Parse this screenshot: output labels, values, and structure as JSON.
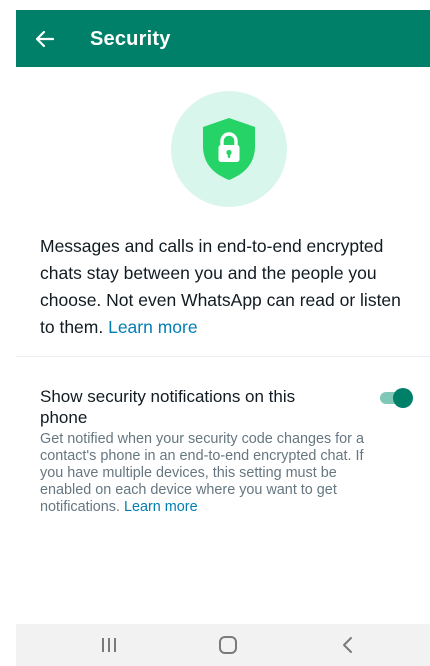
{
  "app_bar": {
    "title": "Security",
    "background": "#008069",
    "back_icon": "arrow-left-icon"
  },
  "hero": {
    "icon": "shield-lock-icon",
    "circle_color": "#d9f6ec",
    "shield_color": "#25d366",
    "text": "Messages and calls in end-to-end encrypted chats stay between you and the people you choose. Not even WhatsApp can read or listen to them. ",
    "link": "Learn more"
  },
  "setting": {
    "title": "Show security notifications on this phone",
    "description": "Get notified when your security code changes for a contact's phone in an end-to-end encrypted chat. If you have multiple devices, this setting must be enabled on each device where you want to get notifications. ",
    "link": "Learn more",
    "toggle_on": true,
    "toggle_color": "#008069"
  },
  "system_nav": {
    "recents_icon": "recents-icon",
    "home_icon": "home-icon",
    "back_icon": "back-chevron-icon"
  },
  "colors": {
    "link": "#027eb5",
    "secondary_text": "#667781"
  }
}
